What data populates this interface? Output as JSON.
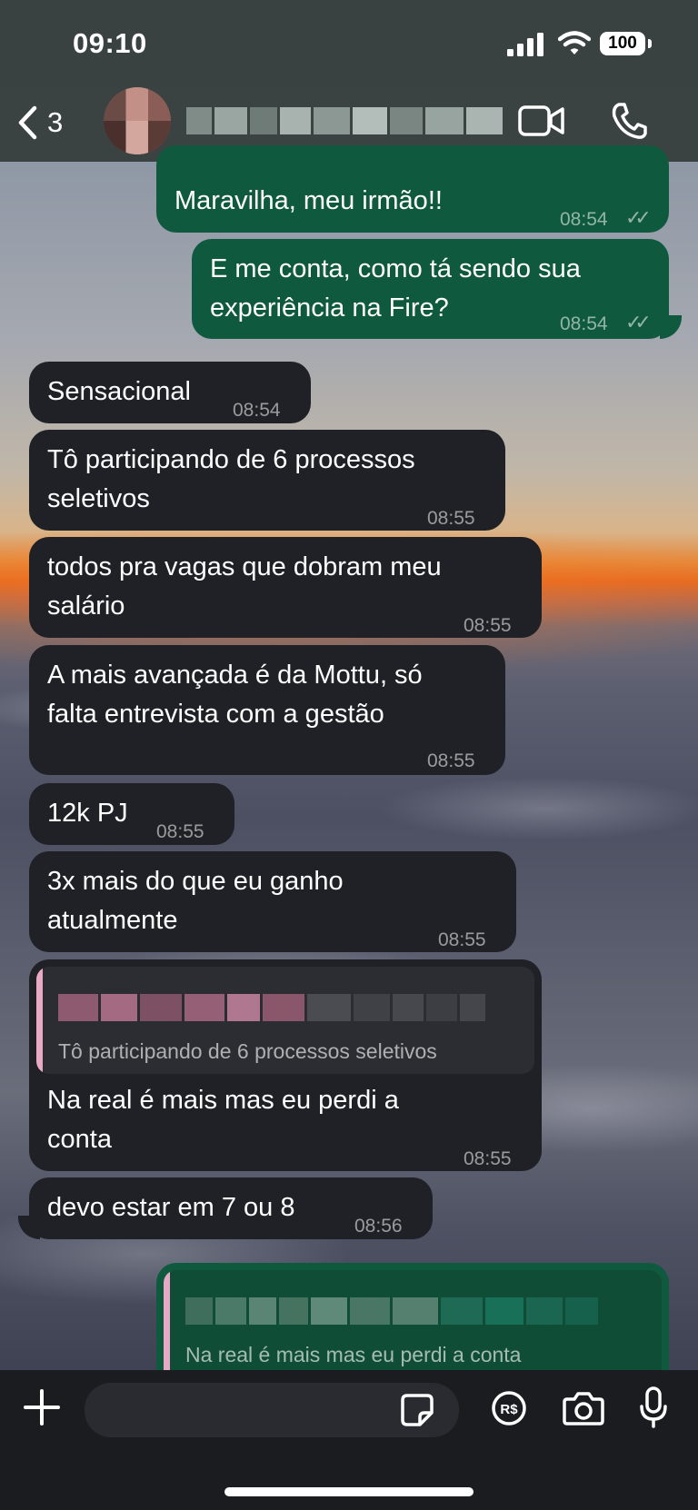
{
  "status_bar": {
    "time": "09:10",
    "battery": "100"
  },
  "header": {
    "back_count": "3",
    "icons": [
      "chevron-left-icon",
      "video-camera-icon",
      "phone-icon"
    ]
  },
  "messages": [
    {
      "direction": "out",
      "text": "Maravilha, meu irmão!!",
      "time": "08:54",
      "read": true
    },
    {
      "direction": "out",
      "text_lines": [
        "E me conta, como tá sendo sua",
        "experiência na Fire?"
      ],
      "time": "08:54",
      "read": true
    },
    {
      "direction": "in",
      "text": "Sensacional",
      "time": "08:54"
    },
    {
      "direction": "in",
      "text_lines": [
        "Tô participando de 6 processos",
        "seletivos"
      ],
      "time": "08:55"
    },
    {
      "direction": "in",
      "text_lines": [
        "todos pra vagas que dobram meu",
        "salário"
      ],
      "time": "08:55"
    },
    {
      "direction": "in",
      "text_lines": [
        "A mais avançada é da Mottu, só",
        "falta entrevista com a gestão"
      ],
      "time": "08:55"
    },
    {
      "direction": "in",
      "text": "12k PJ",
      "time": "08:55"
    },
    {
      "direction": "in",
      "text_lines": [
        "3x mais do que eu ganho",
        "atualmente"
      ],
      "time": "08:55"
    },
    {
      "direction": "in",
      "quote": "Tô participando de 6 processos seletivos",
      "text_lines": [
        "Na real é mais mas eu perdi a",
        "conta"
      ],
      "time": "08:55"
    },
    {
      "direction": "in",
      "text": "devo estar em 7 ou 8",
      "time": "08:56"
    },
    {
      "direction": "out",
      "quote": "Na real é mais mas eu perdi a conta"
    }
  ],
  "input_bar": {
    "placeholder": "",
    "icons": [
      "plus-icon",
      "sticker-icon",
      "pix-payment-icon",
      "camera-icon",
      "microphone-icon"
    ],
    "pix_label": "R$"
  },
  "colors": {
    "outgoing_bubble": "#0f5a3e",
    "incoming_bubble": "#1f2126",
    "quote_bar": "#e7a9c3"
  }
}
